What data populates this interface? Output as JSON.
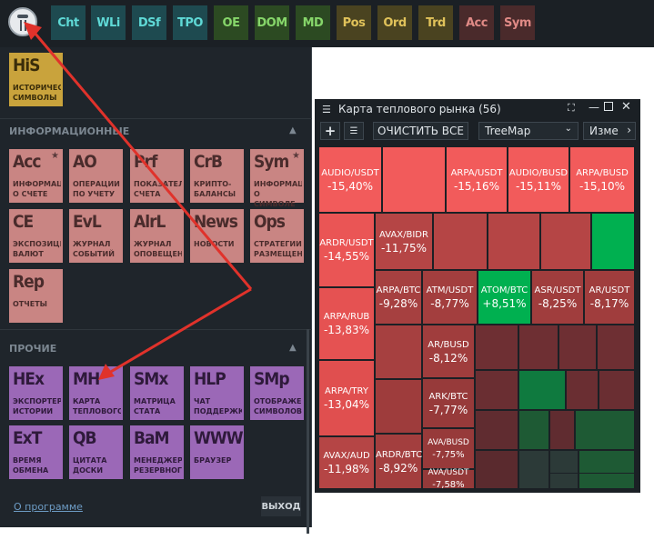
{
  "toolbar": {
    "buttons": [
      {
        "label": "Cht",
        "bg": "#1e4a50",
        "fg": "#5fd9d6"
      },
      {
        "label": "WLi",
        "bg": "#1e4a50",
        "fg": "#5fd9d6"
      },
      {
        "label": "DSf",
        "bg": "#1e4a50",
        "fg": "#5fd9d6"
      },
      {
        "label": "TPO",
        "bg": "#1e4a50",
        "fg": "#5fd9d6"
      },
      {
        "label": "OE",
        "bg": "#2c4a22",
        "fg": "#86d66a"
      },
      {
        "label": "DOM",
        "bg": "#2c4a22",
        "fg": "#86d66a"
      },
      {
        "label": "MD",
        "bg": "#2c4a22",
        "fg": "#86d66a"
      },
      {
        "label": "Pos",
        "bg": "#4a4320",
        "fg": "#e0c25a"
      },
      {
        "label": "Ord",
        "bg": "#4a4320",
        "fg": "#e0c25a"
      },
      {
        "label": "Trd",
        "bg": "#4a4320",
        "fg": "#e0c25a"
      },
      {
        "label": "Acc",
        "bg": "#4a2a2b",
        "fg": "#e08a86"
      },
      {
        "label": "Sym",
        "bg": "#4a2a2b",
        "fg": "#e08a86"
      }
    ]
  },
  "menu": {
    "top_tile": {
      "abbr": "HiS",
      "desc": "ИСТОРИЧЕСК\nСИМВОЛЫ"
    },
    "section_info": "ИНФОРМАЦИОННЫЕ",
    "info_tiles": [
      {
        "abbr": "Acc",
        "desc": "ИНФОРМАЦИ\nО СЧЕТЕ",
        "star": true
      },
      {
        "abbr": "AO",
        "desc": "ОПЕРАЦИИ\nПО УЧЕТУ"
      },
      {
        "abbr": "Prf",
        "desc": "ПОКАЗАТЕЛИ\nСЧЕТА"
      },
      {
        "abbr": "CrB",
        "desc": "КРИПТО-\nБАЛАНСЫ"
      },
      {
        "abbr": "Sym",
        "desc": "ИНФОРМАЦИ\nО СИМВОЛЕ",
        "star": true
      },
      {
        "abbr": "CE",
        "desc": "ЭКСПОЗИЦИ\nВАЛЮТ"
      },
      {
        "abbr": "EvL",
        "desc": "ЖУРНАЛ\nСОБЫТИЙ"
      },
      {
        "abbr": "AlrL",
        "desc": "ЖУРНАЛ\nОПОВЕЩЕНИ"
      },
      {
        "abbr": "News",
        "desc": "НОВОСТИ"
      },
      {
        "abbr": "Ops",
        "desc": "СТРАТЕГИИ\nРАЗМЕЩЕНИ"
      },
      {
        "abbr": "Rep",
        "desc": "ОТЧЕТЫ"
      }
    ],
    "section_other": "ПРОЧИЕ",
    "other_tiles": [
      {
        "abbr": "HEx",
        "desc": "ЭКСПОРТЕР\nИСТОРИИ"
      },
      {
        "abbr": "MH",
        "desc": "КАРТА\nТЕПЛОВОГО"
      },
      {
        "abbr": "SMx",
        "desc": "МАТРИЦА\nСТАТА"
      },
      {
        "abbr": "HLP",
        "desc": "ЧАТ\nПОДДЕРЖКИ"
      },
      {
        "abbr": "SMp",
        "desc": "ОТОБРАЖЕНИ\nСИМВОЛОВ"
      },
      {
        "abbr": "ExT",
        "desc": "ВРЕМЯ\nОБМЕНА"
      },
      {
        "abbr": "QB",
        "desc": "ЦИТАТА\nДОСКИ"
      },
      {
        "abbr": "BaM",
        "desc": "МЕНЕДЖЕР\nРЕЗЕРВНОГО"
      },
      {
        "abbr": "WWW",
        "desc": "БРАУЗЕР"
      }
    ],
    "about_link": "О программе",
    "exit_button": "ВЫХОД"
  },
  "heatmap": {
    "title": "Карта теплового рынка (56)",
    "add_label": "+",
    "clear_label": "ОЧИСТИТЬ ВСЕ",
    "mode_value": "TreeMap",
    "measure_label": "Изме",
    "cells": [
      {
        "name": "AUDIO/USDT",
        "pct": "-15,40%",
        "color": "#f25b5b"
      },
      {
        "name": "",
        "pct": "",
        "color": "#f25b5b"
      },
      {
        "name": "ARPA/USDT",
        "pct": "-15,16%",
        "color": "#f25b5b"
      },
      {
        "name": "AUDIO/BUSD",
        "pct": "-15,11%",
        "color": "#f25b5b"
      },
      {
        "name": "ARPA/BUSD",
        "pct": "-15,10%",
        "color": "#f25b5b"
      },
      {
        "name": "ARDR/USDT",
        "pct": "-14,55%",
        "color": "#ea5555"
      },
      {
        "name": "AVAX/BIDR",
        "pct": "-11,75%",
        "color": "#b54545"
      },
      {
        "name": "",
        "pct": "",
        "color": "#b54545"
      },
      {
        "name": "",
        "pct": "",
        "color": "#b54545"
      },
      {
        "name": "",
        "pct": "",
        "color": "#b54545"
      },
      {
        "name": "",
        "pct": "",
        "color": "#00b050"
      },
      {
        "name": "ARPA/BTC",
        "pct": "-9,28%",
        "color": "#a64040"
      },
      {
        "name": "ATM/USDT",
        "pct": "-8,77%",
        "color": "#a33e3e"
      },
      {
        "name": "ATOM/BTC",
        "pct": "+8,51%",
        "color": "#00b050"
      },
      {
        "name": "ASR/USDT",
        "pct": "-8,25%",
        "color": "#a03d3d"
      },
      {
        "name": "AR/USDT",
        "pct": "-8,17%",
        "color": "#a03d3d"
      },
      {
        "name": "ARPA/RUB",
        "pct": "-13,83%",
        "color": "#e55252"
      },
      {
        "name": "",
        "pct": "",
        "color": "#a64040"
      },
      {
        "name": "AR/BUSD",
        "pct": "-8,12%",
        "color": "#a03d3d"
      },
      {
        "name": "",
        "pct": "",
        "color": "#6e2f33"
      },
      {
        "name": "",
        "pct": "",
        "color": "#6e2f33"
      },
      {
        "name": "",
        "pct": "",
        "color": "#6e2f33"
      },
      {
        "name": "",
        "pct": "",
        "color": "#6e2f33"
      },
      {
        "name": "ARPA/TRY",
        "pct": "-13,04%",
        "color": "#e04f4f"
      },
      {
        "name": "",
        "pct": "",
        "color": "#9e3c3c"
      },
      {
        "name": "ARK/BTC",
        "pct": "-7,77%",
        "color": "#973a3a"
      },
      {
        "name": "",
        "pct": "",
        "color": "#6a2e32"
      },
      {
        "name": "",
        "pct": "",
        "color": "#0f7a3f"
      },
      {
        "name": "",
        "pct": "",
        "color": "#6a2e32"
      },
      {
        "name": "",
        "pct": "",
        "color": "#6a2e32"
      },
      {
        "name": "AVA/BUSD",
        "pct": "-7,75%",
        "color": "#973a3a"
      },
      {
        "name": "",
        "pct": "",
        "color": "#602c30"
      },
      {
        "name": "",
        "pct": "",
        "color": "#1e5a34"
      },
      {
        "name": "",
        "pct": "",
        "color": "#602c30"
      },
      {
        "name": "",
        "pct": "",
        "color": "#1e5a34"
      },
      {
        "name": "AVAX/AUD",
        "pct": "-11,98%",
        "color": "#b54545"
      },
      {
        "name": "ARDR/BTC",
        "pct": "-8,92%",
        "color": "#a33e3e"
      },
      {
        "name": "AVA/USDT",
        "pct": "-7,58%",
        "color": "#943939"
      },
      {
        "name": "",
        "pct": "",
        "color": "#5a2a2e"
      },
      {
        "name": "",
        "pct": "",
        "color": "#2c3a38"
      },
      {
        "name": "",
        "pct": "",
        "color": "#2c3a38"
      },
      {
        "name": "",
        "pct": "",
        "color": "#1e5a34"
      },
      {
        "name": "",
        "pct": "",
        "color": "#2c3a38"
      },
      {
        "name": "",
        "pct": "",
        "color": "#1e5a34"
      }
    ]
  }
}
